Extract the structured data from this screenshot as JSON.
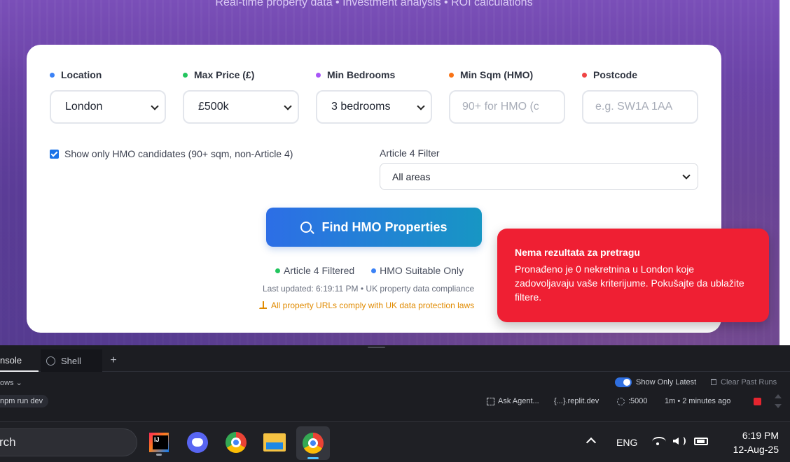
{
  "hero": {
    "tagline": "Real-time property data • Investment analysis • ROI calculations"
  },
  "colors": {
    "location_dot": "#3b82f6",
    "price_dot": "#22c55e",
    "bedrooms_dot": "#a855f7",
    "sqm_dot": "#f97316",
    "postcode_dot": "#ef4444",
    "accent": "#2d6ee6",
    "toast_bg": "#ef1f33"
  },
  "filters": {
    "location": {
      "label": "Location",
      "value": "London"
    },
    "max_price": {
      "label": "Max Price (£)",
      "value": "£500k"
    },
    "min_bedrooms": {
      "label": "Min Bedrooms",
      "value": "3 bedrooms"
    },
    "min_sqm": {
      "label": "Min Sqm (HMO)",
      "placeholder": "90+ for HMO (c"
    },
    "postcode": {
      "label": "Postcode",
      "placeholder": "e.g. SW1A 1AA"
    }
  },
  "hmo_checkbox": {
    "label": "Show only HMO candidates (90+ sqm, non-Article 4)",
    "checked": true
  },
  "article4": {
    "label": "Article 4 Filter",
    "value": "All areas"
  },
  "search_button": {
    "label": "Find HMO Properties",
    "icon": "search-icon"
  },
  "legend": [
    {
      "label": "Article 4 Filtered",
      "color": "#22c55e"
    },
    {
      "label": "HMO Suitable Only",
      "color": "#3b82f6"
    }
  ],
  "last_updated": "Last updated: 6:19:11 PM • UK property data compliance",
  "compliance_note": "All property URLs comply with UK data protection laws",
  "toast": {
    "title": "Nema rezultata za pretragu",
    "body": "Pronađeno je 0 nekretnina u London koje zadovoljavaju vaše kriterijume. Pokušajte da ublažite filtere."
  },
  "replit": {
    "tabs": [
      "nsole",
      "Shell"
    ],
    "add_tab": "+",
    "workflows": "ows ⌄",
    "show_only_latest": "Show Only Latest",
    "clear_past_runs": "Clear Past Runs",
    "run_command": "npm run dev",
    "ask_agent": "Ask Agent...",
    "domain": "{...}.replit.dev",
    "port": ":5000",
    "runtime": "1m • 2 minutes ago"
  },
  "taskbar": {
    "search_text": "rch",
    "language": "ENG",
    "time": "6:19 PM",
    "date": "12-Aug-25"
  }
}
